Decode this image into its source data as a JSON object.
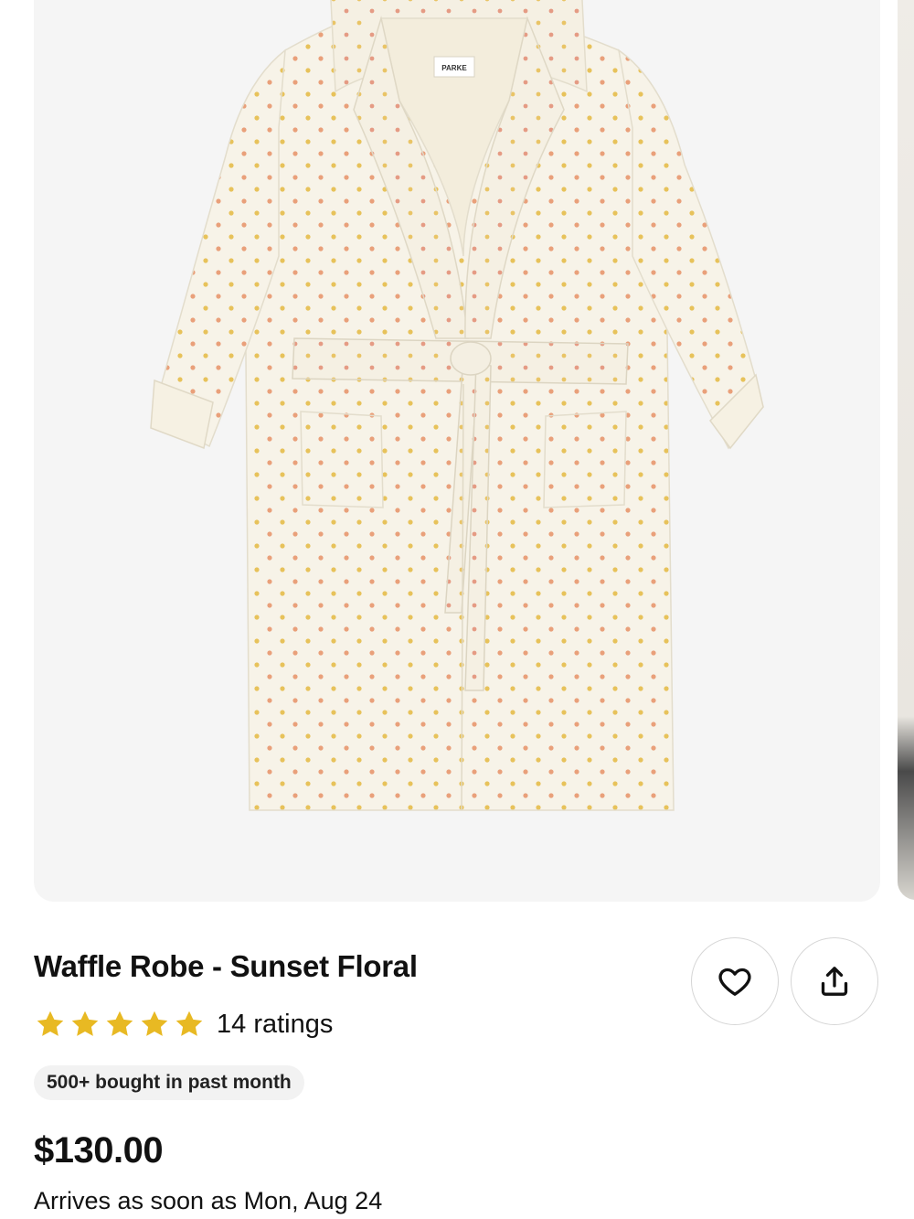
{
  "product": {
    "title": "Waffle Robe - Sunset Floral",
    "rating_stars": 5,
    "ratings_label": "14 ratings",
    "bought_badge": "500+ bought in past month",
    "price": "$130.00",
    "delivery": "Arrives as soon as Mon, Aug 24"
  },
  "image": {
    "brand_tag": "PARKE",
    "subject_icon": "robe-image"
  },
  "actions": {
    "favorite_icon": "heart-icon",
    "share_icon": "share-icon"
  },
  "colors": {
    "star": "#E8B923",
    "card_bg": "#F5F5F5",
    "badge_bg": "#F2F2F2",
    "text": "#111111"
  }
}
